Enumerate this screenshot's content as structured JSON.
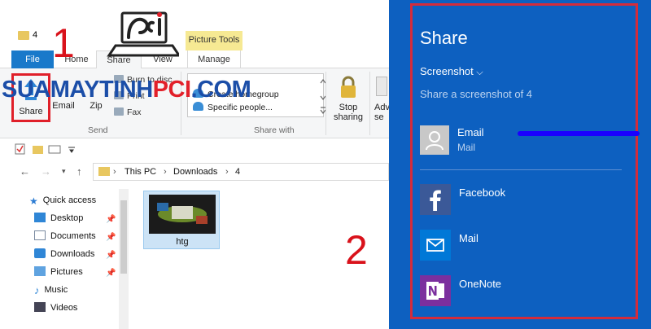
{
  "window": {
    "title": "4",
    "context_tab": "Picture Tools"
  },
  "tabs": {
    "file": "File",
    "home": "Home",
    "share": "Share",
    "view": "View",
    "manage": "Manage"
  },
  "ribbon": {
    "share_label": "Share",
    "email_label": "Email",
    "zip_label": "Zip",
    "burn_label": "Burn to disc",
    "print_label": "Print",
    "fax_label": "Fax",
    "send_group": "Send",
    "homegroup_label": "Create homegroup",
    "specific_people_label": "Specific people...",
    "share_with_group": "Share with",
    "stop_line1": "Stop",
    "stop_line2": "sharing",
    "advanced_line1": "Adv",
    "advanced_line2": "se"
  },
  "watermark": {
    "part1": "SUAMAYTINH",
    "part2": "PCI",
    "part3": ".COM"
  },
  "address": {
    "crumbs": [
      "This PC",
      "Downloads",
      "4"
    ]
  },
  "nav": {
    "items": [
      {
        "label": "Quick access"
      },
      {
        "label": "Desktop"
      },
      {
        "label": "Documents"
      },
      {
        "label": "Downloads"
      },
      {
        "label": "Pictures"
      },
      {
        "label": "Music"
      },
      {
        "label": "Videos"
      }
    ],
    "pin_glyph": "📌"
  },
  "file": {
    "name": "htg"
  },
  "callouts": {
    "one": "1",
    "two": "2"
  },
  "share_pane": {
    "title": "Share",
    "dropdown": "Screenshot",
    "subtitle": "Share a screenshot of 4",
    "email_label": "Email",
    "email_sub": "Mail",
    "apps": [
      {
        "label": "Facebook",
        "icon": "facebook-icon",
        "color": "#3b5998"
      },
      {
        "label": "Mail",
        "icon": "mail-icon",
        "color": "#0078d7"
      },
      {
        "label": "OneNote",
        "icon": "onenote-icon",
        "color": "#7b2f9e"
      }
    ]
  }
}
